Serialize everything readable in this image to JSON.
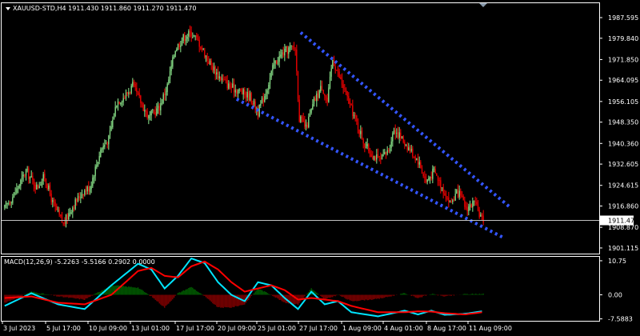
{
  "header": {
    "symbol_line": "XAUUSD-STD,H4  1911.430 1911.860 1911.270 1911.470",
    "macd_line": "MACD(12,26,9) -5.2263 -5.5166 0.2902 0.0000"
  },
  "colors": {
    "background": "#000000",
    "axes": "#ffffff",
    "bull": "#90ee90",
    "bear": "#ff0000",
    "channel": "#3355ff",
    "macd_signal": "#ff0000",
    "macd_main": "#00e5ff",
    "hist_pos": "#008000",
    "hist_neg": "#b00000",
    "price_line": "#c0c0c0"
  },
  "chart_data": [
    {
      "type": "candlestick",
      "title": "XAUUSD-STD,H4",
      "ylim": [
        1899.0,
        1993.0
      ],
      "y_ticks": [
        "1987.595",
        "1979.840",
        "1971.850",
        "1964.095",
        "1956.105",
        "1948.350",
        "1940.360",
        "1932.605",
        "1924.615",
        "1916.860",
        "1908.870",
        "1901.115"
      ],
      "current_price": "1911.470",
      "anchor_closes": [
        [
          0,
          1916
        ],
        [
          8,
          1922
        ],
        [
          16,
          1930
        ],
        [
          24,
          1924
        ],
        [
          30,
          1928
        ],
        [
          36,
          1918
        ],
        [
          44,
          1910
        ],
        [
          50,
          1916
        ],
        [
          58,
          1922
        ],
        [
          64,
          1924
        ],
        [
          72,
          1938
        ],
        [
          78,
          1942
        ],
        [
          84,
          1956
        ],
        [
          90,
          1958
        ],
        [
          96,
          1962
        ],
        [
          102,
          1956
        ],
        [
          108,
          1950
        ],
        [
          116,
          1954
        ],
        [
          122,
          1962
        ],
        [
          128,
          1976
        ],
        [
          134,
          1980
        ],
        [
          140,
          1982
        ],
        [
          146,
          1978
        ],
        [
          152,
          1972
        ],
        [
          160,
          1966
        ],
        [
          168,
          1962
        ],
        [
          176,
          1960
        ],
        [
          184,
          1958
        ],
        [
          190,
          1952
        ],
        [
          196,
          1960
        ],
        [
          202,
          1970
        ],
        [
          208,
          1974
        ],
        [
          214,
          1976
        ],
        [
          218,
          1976
        ],
        [
          221,
          1950
        ],
        [
          226,
          1946
        ],
        [
          232,
          1956
        ],
        [
          238,
          1962
        ],
        [
          242,
          1956
        ],
        [
          246,
          1972
        ],
        [
          252,
          1964
        ],
        [
          258,
          1956
        ],
        [
          264,
          1948
        ],
        [
          270,
          1940
        ],
        [
          276,
          1936
        ],
        [
          282,
          1934
        ],
        [
          288,
          1938
        ],
        [
          292,
          1946
        ],
        [
          298,
          1942
        ],
        [
          304,
          1938
        ],
        [
          310,
          1934
        ],
        [
          316,
          1926
        ],
        [
          322,
          1930
        ],
        [
          328,
          1924
        ],
        [
          334,
          1918
        ],
        [
          340,
          1922
        ],
        [
          346,
          1916
        ],
        [
          352,
          1918
        ],
        [
          358,
          1912
        ]
      ],
      "channel_upper": [
        [
          222,
          1982
        ],
        [
          380,
          1916
        ]
      ],
      "channel_lower": [
        [
          174,
          1957
        ],
        [
          374,
          1905
        ]
      ]
    },
    {
      "type": "line",
      "title": "MACD(12,26,9)",
      "ylim": [
        -8.2,
        12.0
      ],
      "y_ticks": [
        "10.75",
        "0.00",
        "-7.5883"
      ],
      "series": [
        {
          "name": "main",
          "points": [
            [
              0,
              -3.5
            ],
            [
              20,
              0.5
            ],
            [
              40,
              -3
            ],
            [
              60,
              -4.5
            ],
            [
              80,
              3
            ],
            [
              100,
              9.8
            ],
            [
              110,
              8
            ],
            [
              120,
              2
            ],
            [
              130,
              6
            ],
            [
              140,
              11.5
            ],
            [
              150,
              10
            ],
            [
              160,
              4
            ],
            [
              170,
              0
            ],
            [
              180,
              -2
            ],
            [
              190,
              4
            ],
            [
              200,
              3
            ],
            [
              210,
              -1
            ],
            [
              220,
              -4.5
            ],
            [
              230,
              1
            ],
            [
              240,
              -3
            ],
            [
              250,
              -2
            ],
            [
              260,
              -5.5
            ],
            [
              280,
              -6.8
            ],
            [
              300,
              -5
            ],
            [
              310,
              -6.2
            ],
            [
              320,
              -5
            ],
            [
              330,
              -6.3
            ],
            [
              345,
              -6
            ],
            [
              358,
              -5.2
            ]
          ]
        },
        {
          "name": "signal",
          "points": [
            [
              0,
              -1
            ],
            [
              20,
              -0.5
            ],
            [
              40,
              -2.5
            ],
            [
              60,
              -3
            ],
            [
              80,
              0
            ],
            [
              100,
              7.5
            ],
            [
              110,
              8.5
            ],
            [
              120,
              6
            ],
            [
              130,
              5.5
            ],
            [
              140,
              9
            ],
            [
              150,
              10.5
            ],
            [
              160,
              8
            ],
            [
              170,
              4
            ],
            [
              180,
              1
            ],
            [
              190,
              2
            ],
            [
              200,
              3
            ],
            [
              210,
              1.5
            ],
            [
              220,
              -1.5
            ],
            [
              230,
              -1
            ],
            [
              240,
              -1.5
            ],
            [
              250,
              -2
            ],
            [
              260,
              -3.5
            ],
            [
              280,
              -5.5
            ],
            [
              300,
              -5.5
            ],
            [
              310,
              -5.2
            ],
            [
              320,
              -5.3
            ],
            [
              330,
              -5.8
            ],
            [
              345,
              -6.2
            ],
            [
              358,
              -5.5
            ]
          ]
        }
      ],
      "histogram": [
        [
          0,
          -2.5
        ],
        [
          20,
          1
        ],
        [
          40,
          -0.5
        ],
        [
          60,
          -1.5
        ],
        [
          80,
          3
        ],
        [
          100,
          2.3
        ],
        [
          110,
          -0.5
        ],
        [
          120,
          -4
        ],
        [
          130,
          0.5
        ],
        [
          140,
          2.5
        ],
        [
          150,
          -0.5
        ],
        [
          160,
          -4
        ],
        [
          170,
          -4
        ],
        [
          180,
          -3
        ],
        [
          190,
          2
        ],
        [
          200,
          0
        ],
        [
          210,
          -2.5
        ],
        [
          220,
          -3
        ],
        [
          230,
          2
        ],
        [
          240,
          -1.5
        ],
        [
          250,
          0
        ],
        [
          260,
          -2
        ],
        [
          280,
          -1.3
        ],
        [
          300,
          0.5
        ],
        [
          310,
          -1
        ],
        [
          320,
          0.3
        ],
        [
          330,
          -0.5
        ],
        [
          345,
          0.2
        ],
        [
          358,
          0.3
        ]
      ]
    }
  ],
  "time_axis": [
    "3 Jul 2023",
    "5 Jul 17:00",
    "10 Jul 09:00",
    "13 Jul 01:00",
    "17 Jul 17:00",
    "20 Jul 09:00",
    "25 Jul 01:00",
    "27 Jul 17:00",
    "1 Aug 09:00",
    "4 Aug 01:00",
    "8 Aug 17:00",
    "11 Aug 09:00"
  ]
}
